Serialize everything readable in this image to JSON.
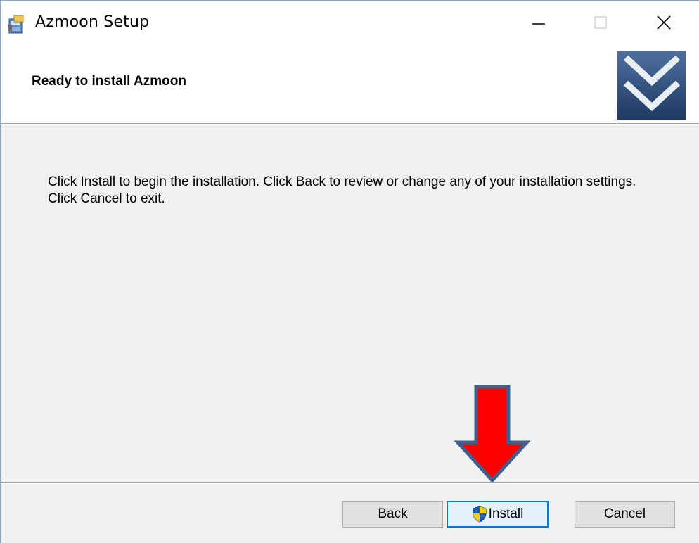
{
  "window": {
    "title": "Azmoon Setup"
  },
  "banner": {
    "title": "Ready to install Azmoon"
  },
  "body": {
    "instructions": "Click Install to begin the installation. Click Back to review or change any of your installation settings. Click Cancel to exit."
  },
  "buttons": {
    "back": "Back",
    "install": "Install",
    "cancel": "Cancel"
  },
  "icons": {
    "app": "installer-package-icon",
    "minimize": "minimize-icon",
    "maximize": "maximize-icon",
    "close": "close-icon",
    "banner": "double-chevron-down-icon",
    "uac": "uac-shield-icon",
    "annotation": "red-arrow-down-icon"
  },
  "colors": {
    "focus_border": "#0078d7",
    "banner_logo_bg": "#2c4a73",
    "annotation_arrow": "#ff0000",
    "annotation_outline": "#3f5f8f"
  }
}
